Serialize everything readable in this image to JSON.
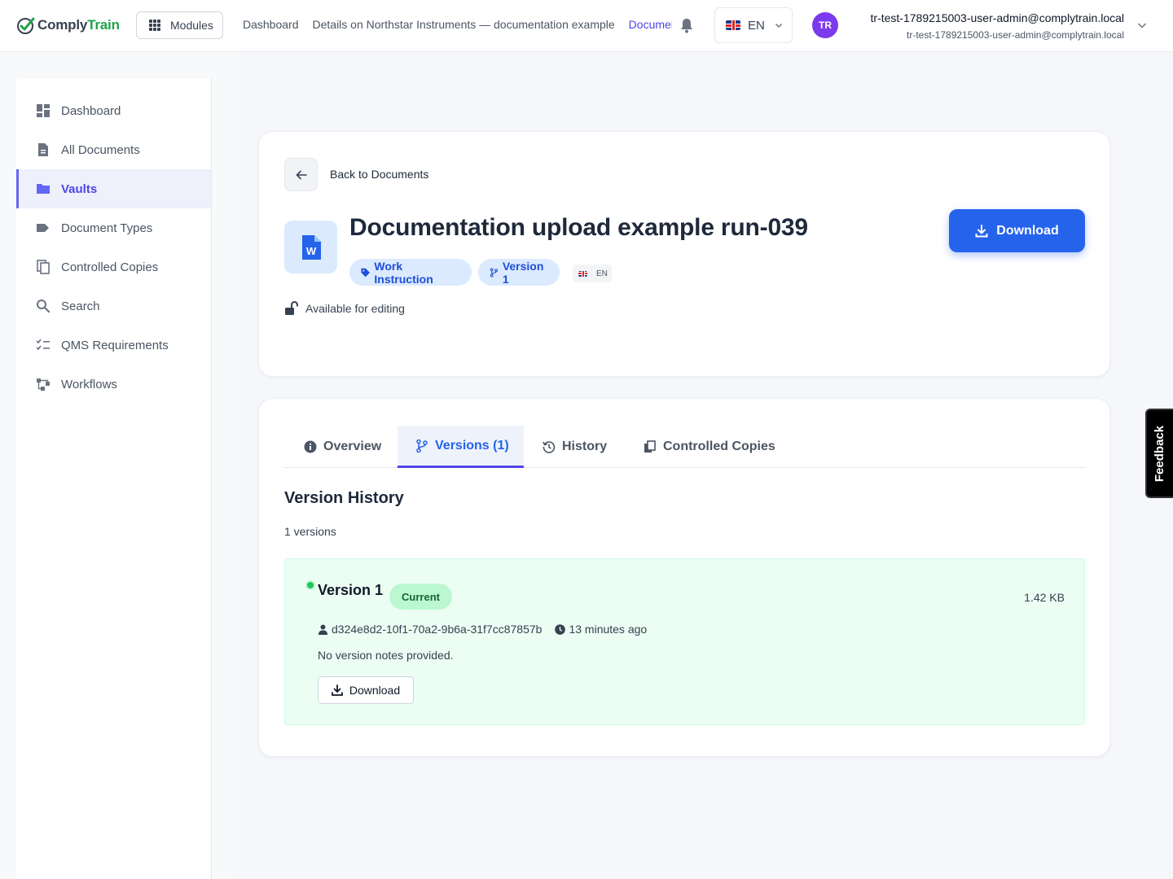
{
  "app": {
    "logo_a": "Comply",
    "logo_b": "Train"
  },
  "header": {
    "modules_label": "Modules",
    "breadcrumbs": [
      "Dashboard",
      "Details on Northstar Instruments — documentation example",
      "Documentation upload example run-039"
    ],
    "language": "EN",
    "user_initials": "TR",
    "user_name": "tr-test-1789215003-user-admin@complytrain.local",
    "user_email": "tr-test-1789215003-user-admin@complytrain.local"
  },
  "sidebar": {
    "items": [
      {
        "label": "Dashboard",
        "icon": "dashboard-icon"
      },
      {
        "label": "All Documents",
        "icon": "document-icon"
      },
      {
        "label": "Vaults",
        "icon": "folder-icon"
      },
      {
        "label": "Document Types",
        "icon": "tag-icon"
      },
      {
        "label": "Controlled Copies",
        "icon": "copies-icon"
      },
      {
        "label": "Search",
        "icon": "search-icon"
      },
      {
        "label": "QMS Requirements",
        "icon": "checklist-icon"
      },
      {
        "label": "Workflows",
        "icon": "workflow-icon"
      }
    ],
    "active": "Vaults"
  },
  "document": {
    "back_label": "Back to Documents",
    "title": "Documentation upload example run-039",
    "type_badge": "Work Instruction",
    "version_badge": "Version 1",
    "language_badge": "EN",
    "lock_status": "Available for editing",
    "download_label": "Download",
    "file_icon_letter": "W"
  },
  "tabs": [
    {
      "label": "Overview",
      "icon": "info-icon"
    },
    {
      "label": "Versions (1)",
      "icon": "branch-icon"
    },
    {
      "label": "History",
      "icon": "history-icon"
    },
    {
      "label": "Controlled Copies",
      "icon": "copies-icon"
    }
  ],
  "active_tab": "Versions (1)",
  "versions": {
    "title": "Version History",
    "count_label": "1 versions",
    "items": [
      {
        "name": "Version 1",
        "status": "Current",
        "size": "1.42 KB",
        "author": "d324e8d2-10f1-70a2-9b6a-31f7cc87857b",
        "time": "13 minutes ago",
        "notes": "No version notes provided.",
        "download_label": "Download"
      }
    ]
  },
  "feedback_label": "Feedback",
  "colors": {
    "accent": "#2563eb",
    "nav_active": "#4f46e5",
    "current_bg": "#ecfdf3",
    "logo_green": "#22a34a"
  }
}
